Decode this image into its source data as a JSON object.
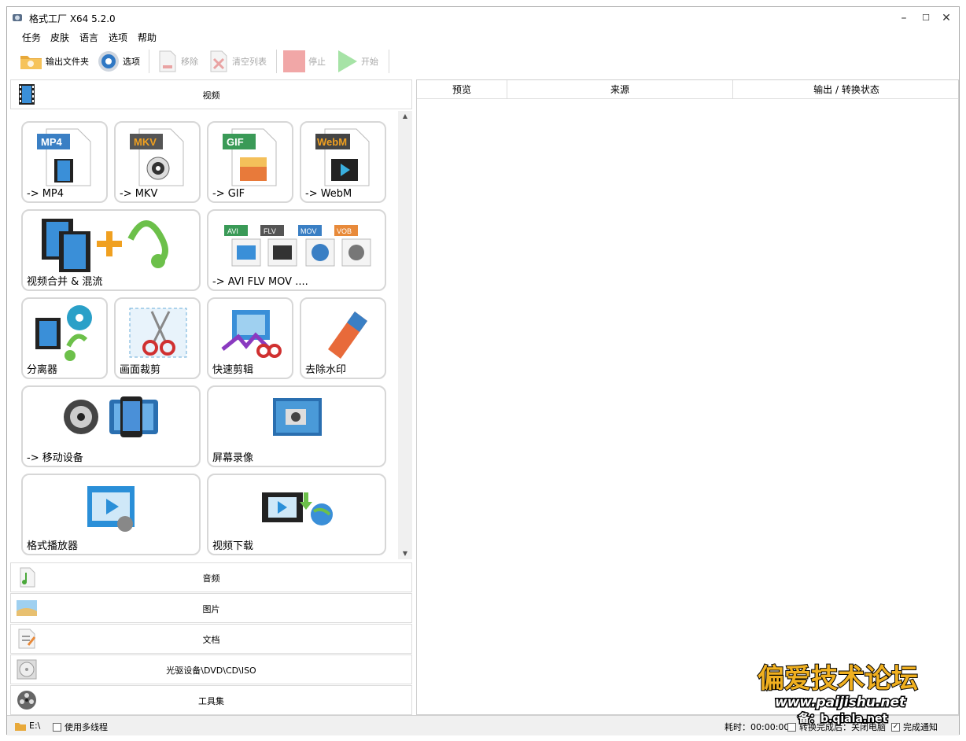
{
  "window": {
    "title": "格式工厂 X64 5.2.0",
    "min": "–",
    "max": "☐",
    "close": "✕"
  },
  "menu": [
    "任务",
    "皮肤",
    "语言",
    "选项",
    "帮助"
  ],
  "toolbar": {
    "output_folder": "输出文件夹",
    "options": "选项",
    "remove": "移除",
    "clear_list": "清空列表",
    "stop": "停止",
    "start": "开始"
  },
  "video_category": {
    "label": "视频"
  },
  "tiles": [
    {
      "label": "-> MP4",
      "badge": "MP4",
      "badge_color": "#3a7fc4"
    },
    {
      "label": "-> MKV",
      "badge": "MKV",
      "badge_color": "#555555"
    },
    {
      "label": "-> GIF",
      "badge": "GIF",
      "badge_color": "#3a9a57"
    },
    {
      "label": "-> WebM",
      "badge": "WebM",
      "badge_color": "#444444"
    },
    {
      "label": "视频合并 & 混流"
    },
    {
      "label": "-> AVI FLV MOV ....",
      "badges": [
        "AVI",
        "FLV",
        "MOV",
        "VOB"
      ]
    },
    {
      "label": "分离器"
    },
    {
      "label": "画面裁剪"
    },
    {
      "label": "快速剪辑"
    },
    {
      "label": "去除水印"
    },
    {
      "label": "-> 移动设备"
    },
    {
      "label": "屏幕录像"
    },
    {
      "label": "格式播放器"
    },
    {
      "label": "视频下载"
    }
  ],
  "categories": [
    {
      "label": "音频",
      "icon": "music-note-icon"
    },
    {
      "label": "图片",
      "icon": "picture-icon"
    },
    {
      "label": "文档",
      "icon": "document-icon"
    },
    {
      "label": "光驱设备\\DVD\\CD\\ISO",
      "icon": "disc-icon"
    },
    {
      "label": "工具集",
      "icon": "film-reel-icon"
    }
  ],
  "grid": {
    "columns": [
      "预览",
      "来源",
      "输出 / 转换状态"
    ]
  },
  "status": {
    "path": "E:\\",
    "multithread": "使用多线程",
    "elapsed": "耗时：00:00:00",
    "shutdown": "转换完成后：关闭电脑",
    "notify": "完成通知",
    "notify_checked": "✓"
  },
  "watermark": {
    "line1": "偏爱技术论坛",
    "line2": "www.paijishu.net",
    "line3": "备：b.qiala.net"
  },
  "colors": {
    "accent": "#3a7fc4",
    "orange": "#f0a020",
    "disabled": "#a9a9a9"
  }
}
